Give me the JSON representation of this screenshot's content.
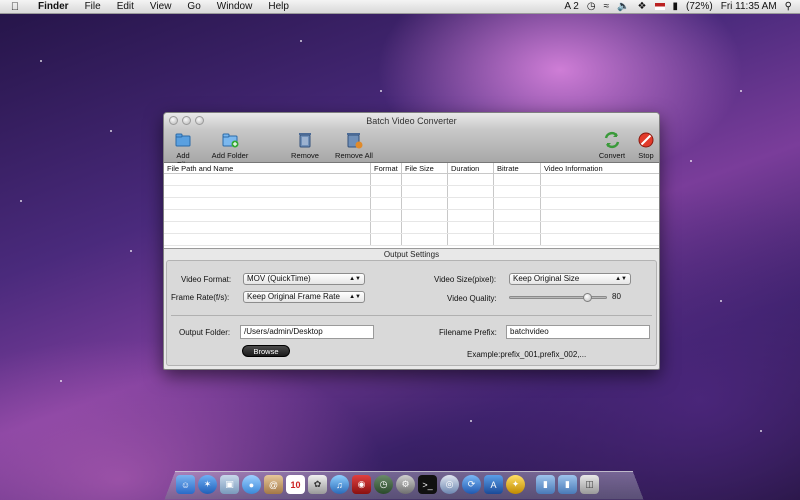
{
  "menubar": {
    "app_name": "Finder",
    "items": [
      "File",
      "Edit",
      "View",
      "Go",
      "Window",
      "Help"
    ],
    "status": {
      "input": "A 2",
      "battery": "(72%)",
      "clock": "Fri 11:35 AM"
    }
  },
  "window": {
    "title": "Batch Video Converter",
    "toolbar": {
      "add_file": "Add File",
      "add_folder": "Add Folder",
      "remove": "Remove",
      "remove_all": "Remove All",
      "convert": "Convert",
      "stop": "Stop"
    },
    "table": {
      "columns": [
        "File Path and Name",
        "Format",
        "File Size",
        "Duration",
        "Bitrate",
        "Video Information"
      ]
    },
    "settings": {
      "title": "Output Settings",
      "video_format_label": "Video Format:",
      "video_format_value": "MOV (QuickTime)",
      "frame_rate_label": "Frame Rate(f/s):",
      "frame_rate_value": "Keep Original Frame Rate",
      "video_size_label": "Video Size(pixel):",
      "video_size_value": "Keep Original Size",
      "video_quality_label": "Video Quality:",
      "video_quality_value": "80",
      "video_quality_fraction": 0.8,
      "output_folder_label": "Output Folder:",
      "output_folder_value": "/Users/admin/Desktop",
      "browse_label": "Browse",
      "filename_prefix_label": "Filename Prefix:",
      "filename_prefix_value": "batchvideo",
      "example_text": "Example:prefix_001,prefix_002,..."
    }
  },
  "dock": {
    "icons": [
      "finder-icon",
      "safari-icon",
      "preview-icon",
      "ichat-icon",
      "address-book-icon",
      "calendar-icon",
      "photo-icon",
      "itunes-icon",
      "photo-booth-icon",
      "time-machine-icon",
      "system-prefs-icon",
      "terminal-icon",
      "network-icon",
      "sync-icon",
      "app-store-icon",
      "misc-icon",
      "folder-icon",
      "folder-icon-2",
      "trash-icon"
    ],
    "calendar_day": "10"
  }
}
